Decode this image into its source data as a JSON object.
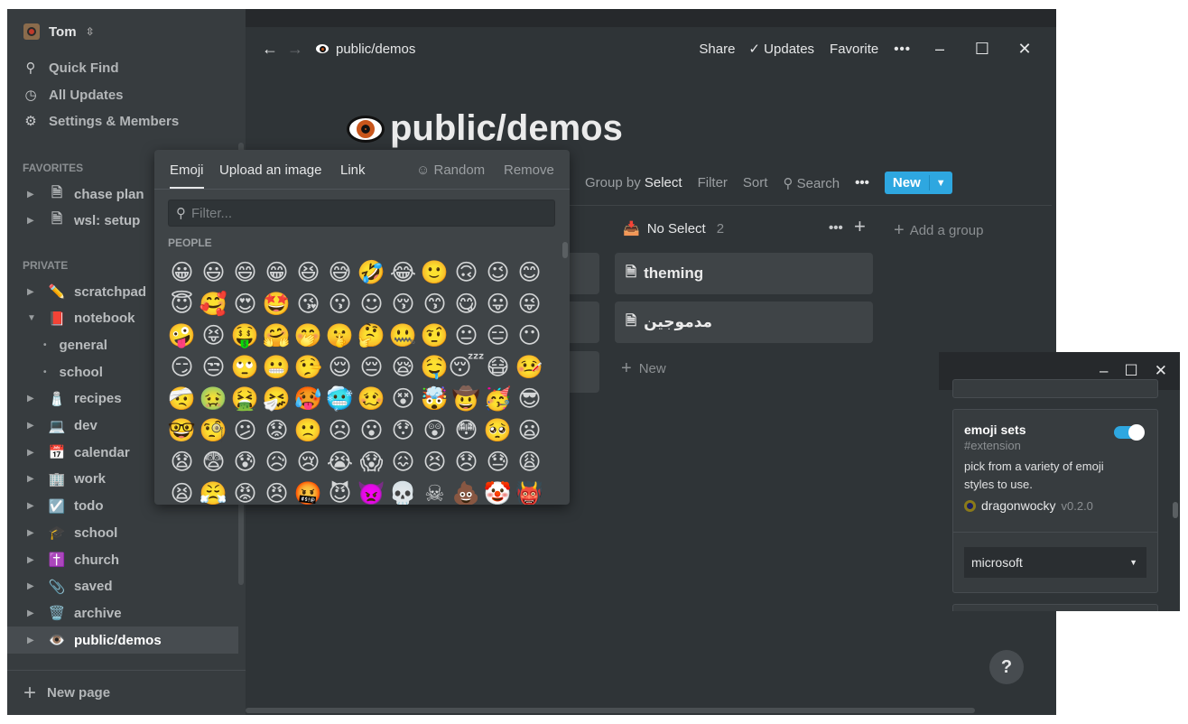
{
  "sidebar": {
    "workspace": "Tom",
    "nav": [
      {
        "icon": "search-icon",
        "label": "Quick Find"
      },
      {
        "icon": "clock-icon",
        "label": "All Updates"
      },
      {
        "icon": "gear-icon",
        "label": "Settings & Members"
      }
    ],
    "favorites_label": "FAVORITES",
    "favorites": [
      {
        "label": "chase plan",
        "emoji": "🗎"
      },
      {
        "label": "wsl: setup",
        "emoji": "🗎"
      }
    ],
    "private_label": "PRIVATE",
    "private": [
      {
        "label": "scratchpad",
        "emoji": "✏️"
      },
      {
        "label": "notebook",
        "emoji": "📕",
        "expanded": true
      },
      {
        "label": "general",
        "sub": true
      },
      {
        "label": "school",
        "sub": true
      },
      {
        "label": "recipes",
        "emoji": "🧂"
      },
      {
        "label": "dev",
        "emoji": "💻"
      },
      {
        "label": "calendar",
        "emoji": "📅"
      },
      {
        "label": "work",
        "emoji": "🏢"
      },
      {
        "label": "todo",
        "emoji": "☑️"
      },
      {
        "label": "school",
        "emoji": "🎓"
      },
      {
        "label": "church",
        "emoji": "✝️"
      },
      {
        "label": "saved",
        "emoji": "📎"
      },
      {
        "label": "archive",
        "emoji": "🗑️"
      },
      {
        "label": "public/demos",
        "emoji": "👁️",
        "active": true
      }
    ],
    "new_page": "New page"
  },
  "header": {
    "breadcrumb": "public/demos",
    "share": "Share",
    "updates": "Updates",
    "favorite": "Favorite"
  },
  "page": {
    "title": "public/demos"
  },
  "toolbar": {
    "partial": "s",
    "group_by": "Group by",
    "group_value": "Select",
    "filter": "Filter",
    "sort": "Sort",
    "search": "Search",
    "new": "New"
  },
  "board": {
    "group_name": "No Select",
    "group_count": "2",
    "add_group": "Add a group",
    "cards": [
      "theming",
      "مدموجين"
    ],
    "new": "New"
  },
  "picker": {
    "tabs": [
      "Emoji",
      "Upload an image",
      "Link"
    ],
    "random": "Random",
    "remove": "Remove",
    "filter_placeholder": "Filter...",
    "category": "PEOPLE",
    "emojis": [
      "😀",
      "😃",
      "😄",
      "😁",
      "😆",
      "😅",
      "🤣",
      "😂",
      "🙂",
      "🙃",
      "😉",
      "😊",
      "😇",
      "🥰",
      "😍",
      "🤩",
      "😘",
      "😗",
      "☺",
      "😚",
      "😙",
      "😋",
      "😛",
      "😜",
      "🤪",
      "😝",
      "🤑",
      "🤗",
      "🤭",
      "🤫",
      "🤔",
      "🤐",
      "🤨",
      "😐",
      "😑",
      "😶",
      "😏",
      "😒",
      "🙄",
      "😬",
      "🤥",
      "😌",
      "😔",
      "😪",
      "🤤",
      "😴",
      "😷",
      "🤒",
      "🤕",
      "🤢",
      "🤮",
      "🤧",
      "🥵",
      "🥶",
      "🥴",
      "😵",
      "🤯",
      "🤠",
      "🥳",
      "😎",
      "🤓",
      "🧐",
      "😕",
      "😟",
      "🙁",
      "☹",
      "😮",
      "😯",
      "😲",
      "😳",
      "🥺",
      "😦",
      "😧",
      "😨",
      "😰",
      "😥",
      "😢",
      "😭",
      "😱",
      "😖",
      "😣",
      "😞",
      "😓",
      "😩",
      "😫",
      "😤",
      "😡",
      "😠",
      "🤬",
      "😈",
      "👿",
      "💀",
      "☠",
      "💩",
      "🤡",
      "👹"
    ]
  },
  "extension": {
    "name": "emoji sets",
    "tag": "#extension",
    "description": "pick from a variety of emoji styles to use.",
    "author": "dragonwocky",
    "version": "v0.2.0",
    "enabled": true,
    "selected": "microsoft"
  },
  "help": "?",
  "colors": {
    "accent": "#2ea7e0",
    "background": "#2f3437",
    "sidebar": "#373c3f"
  }
}
